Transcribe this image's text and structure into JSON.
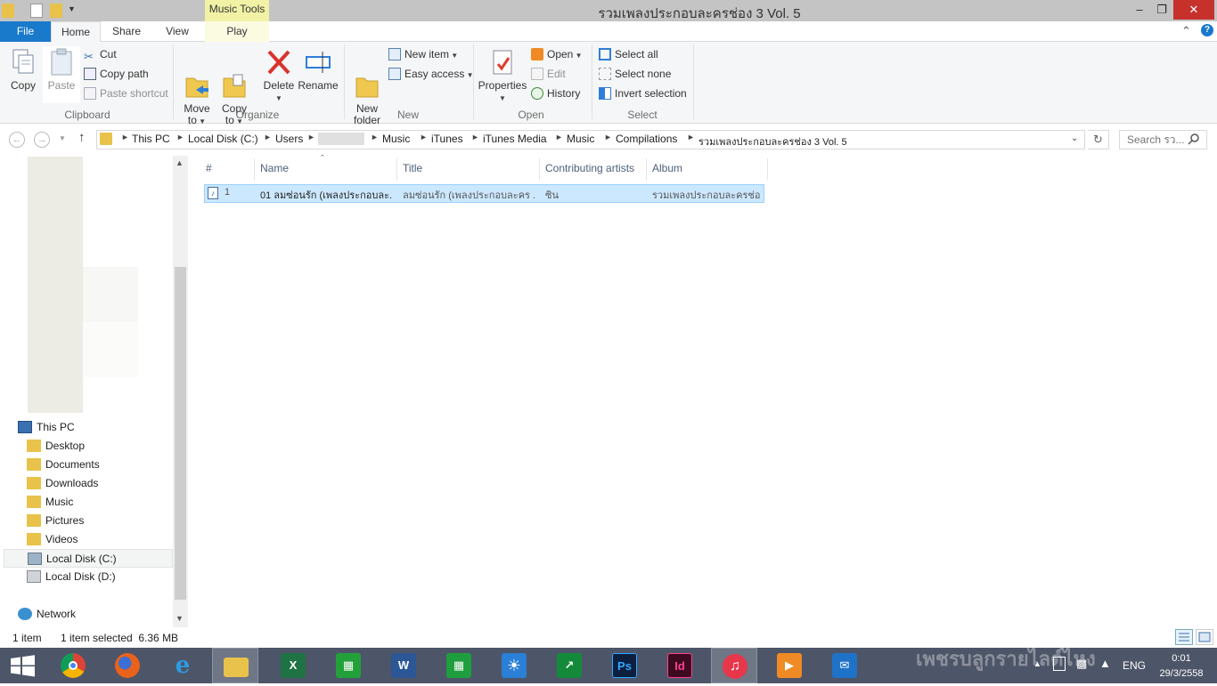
{
  "window": {
    "title": "รวมเพลงประกอบละครช่อง 3 Vol. 5",
    "min_glyph": "–",
    "max_glyph": "❐",
    "close_glyph": "✕",
    "context_tab_header": "Music Tools"
  },
  "ribbon": {
    "tabs": [
      "File",
      "Home",
      "Share",
      "View",
      "Play"
    ],
    "collapse_glyph": "⌃",
    "help_glyph": "?",
    "groups": {
      "clipboard": {
        "label": "Clipboard",
        "copy": "Copy",
        "paste": "Paste",
        "cut": "Cut",
        "copy_path": "Copy path",
        "paste_shortcut": "Paste shortcut"
      },
      "organize": {
        "label": "Organize",
        "move_to": "Move\nto",
        "copy_to": "Copy\nto",
        "delete": "Delete",
        "rename": "Rename"
      },
      "new": {
        "label": "New",
        "new_folder": "New\nfolder",
        "new_item": "New item",
        "easy_access": "Easy access"
      },
      "open": {
        "label": "Open",
        "properties": "Properties",
        "open": "Open",
        "edit": "Edit",
        "history": "History"
      },
      "select": {
        "label": "Select",
        "select_all": "Select all",
        "select_none": "Select none",
        "invert_selection": "Invert selection"
      }
    }
  },
  "address": {
    "back_glyph": "←",
    "forward_glyph": "→",
    "up_glyph": "↑",
    "crumbs": [
      "This PC",
      "Local Disk (C:)",
      "Users",
      "",
      "Music",
      "iTunes",
      "iTunes Media",
      "Music",
      "Compilations",
      "รวมเพลงประกอบละครช่อง 3 Vol. 5"
    ],
    "search_placeholder": "Search รว..."
  },
  "nav_pane": {
    "this_pc": "This PC",
    "children": [
      "Desktop",
      "Documents",
      "Downloads",
      "Music",
      "Pictures",
      "Videos",
      "Local Disk (C:)",
      "Local Disk (D:)"
    ],
    "selected": "Local Disk (C:)",
    "network": "Network"
  },
  "file_list": {
    "columns": [
      "#",
      "Name",
      "Title",
      "Contributing artists",
      "Album"
    ],
    "sort_glyph": "ˆ",
    "rows": [
      {
        "num": "1",
        "name": "01 ลมซ่อนรัก (เพลงประกอบละ...",
        "title": "ลมซ่อนรัก (เพลงประกอบละคร ...",
        "artist": "ซิน",
        "album": "รวมเพลงประกอบละครช่อ..."
      }
    ]
  },
  "status": {
    "count": "1 item",
    "selection": "1 item selected  6.36 MB"
  },
  "taskbar": {
    "apps": [
      "windows-logo",
      "chrome",
      "firefox",
      "internet-explorer",
      "file-explorer",
      "excel",
      "store",
      "word",
      "calculator",
      "weather",
      "finance",
      "photoshop",
      "indesign",
      "itunes",
      "media-player",
      "mail"
    ],
    "tray_language": "ENG",
    "time": "0:01",
    "date": "29/3/2558"
  },
  "colors": {
    "accent": "#1979ca",
    "selection": "#cce8ff",
    "taskbar": "#4d5568",
    "close": "#c7312c",
    "context_tab": "#f2f2a6"
  }
}
